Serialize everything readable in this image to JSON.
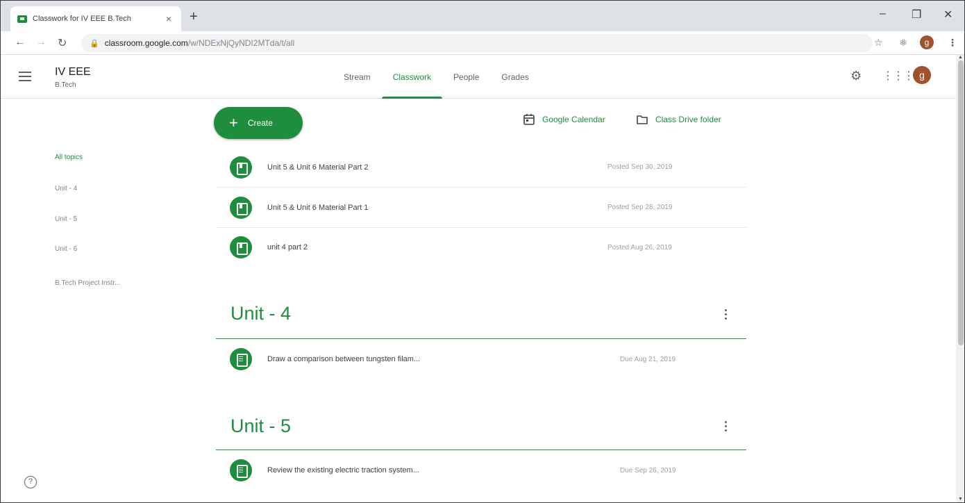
{
  "browser": {
    "tab_title": "Classwork for IV EEE B.Tech",
    "tab_close": "×",
    "new_tab": "+",
    "url_host": "classroom.google.com",
    "url_path": "/w/NDExNjQyNDI2MTda/t/all",
    "profile_initial": "g"
  },
  "header": {
    "class_name": "IV EEE",
    "section": "B.Tech",
    "tabs": [
      {
        "label": "Stream"
      },
      {
        "label": "Classwork"
      },
      {
        "label": "People"
      },
      {
        "label": "Grades"
      }
    ],
    "active_tab": "Classwork",
    "avatar_initial": "g"
  },
  "sidebar": {
    "topics": [
      {
        "label": "All topics"
      },
      {
        "label": "Unit - 4"
      },
      {
        "label": "Unit - 5"
      },
      {
        "label": "Unit - 6"
      },
      {
        "label": "B.Tech Project Instr..."
      }
    ]
  },
  "toolbar": {
    "create_label": "Create",
    "calendar_label": "Google Calendar",
    "drive_label": "Class Drive folder"
  },
  "materials": [
    {
      "title": "Unit 5 & Unit 6 Material Part 2",
      "meta": "Posted Sep 30, 2019"
    },
    {
      "title": "Unit 5 & Unit 6 Material Part 1",
      "meta": "Posted Sep 28, 2019"
    },
    {
      "title": "unit 4 part 2",
      "meta": "Posted Aug 26, 2019"
    }
  ],
  "sections": [
    {
      "title": "Unit - 4",
      "items": [
        {
          "title": "Draw a comparison between tungsten filam...",
          "meta": "Due Aug 21, 2019"
        }
      ]
    },
    {
      "title": "Unit - 5",
      "items": [
        {
          "title": "Review the existing electric traction system...",
          "meta": "Due Sep 26, 2019"
        }
      ]
    }
  ],
  "colors": {
    "accent": "#1e8e3e",
    "avatar": "#a0522d"
  },
  "icons": [
    "menu-icon",
    "settings-icon",
    "apps-grid-icon",
    "calendar-icon",
    "folder-icon",
    "help-icon",
    "more-vert-icon",
    "material-icon",
    "assignment-icon",
    "star-icon",
    "extensions-icon",
    "lock-icon"
  ]
}
